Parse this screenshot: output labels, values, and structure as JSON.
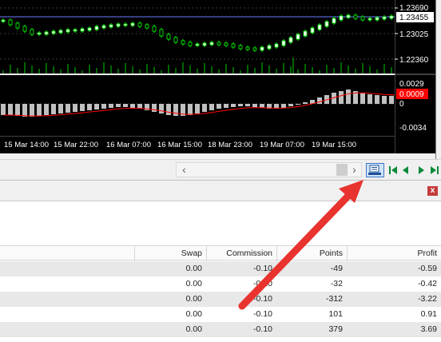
{
  "chart": {
    "price_labels": [
      "1.23690",
      "1.23025",
      "1.22360"
    ],
    "current_price": "1.23455",
    "osc_labels": [
      "0.0029",
      "0",
      "-0.0034"
    ],
    "osc_current": "0.0009",
    "time_labels": [
      "15 Mar 14:00",
      "15 Mar 22:00",
      "16 Mar 07:00",
      "16 Mar 15:00",
      "18 Mar 23:00",
      "19 Mar 07:00",
      "19 Mar 15:00"
    ],
    "colors": {
      "background": "#000000",
      "bull_candle": "#ffffff",
      "bear_candle": "#000000",
      "wick": "#00ff00",
      "volume": "#00cc00",
      "osc_bar": "#c0c0c0",
      "signal_line": "#ff0000",
      "current_price_tag": "#ffffff",
      "osc_tag": "#ff0000"
    }
  },
  "scrollbar": {
    "left_arrow": "‹",
    "right_arrow": "›"
  },
  "nav_icons": [
    "chart-shift-icon",
    "scroll-to-start-icon",
    "scroll-left-icon",
    "scroll-right-icon",
    "scroll-to-end-icon"
  ],
  "terminal": {
    "close_label": "x",
    "columns": [
      "Swap",
      "Commission",
      "Points",
      "Profit"
    ],
    "rows": [
      {
        "swap": "0.00",
        "commission": "-0.10",
        "points": "-49",
        "profit": "-0.59"
      },
      {
        "swap": "0.00",
        "commission": "-0.10",
        "points": "-32",
        "profit": "-0.42"
      },
      {
        "swap": "0.00",
        "commission": "-0.10",
        "points": "-312",
        "profit": "-3.22"
      },
      {
        "swap": "0.00",
        "commission": "-0.10",
        "points": "101",
        "profit": "0.91"
      },
      {
        "swap": "0.00",
        "commission": "-0.10",
        "points": "379",
        "profit": "3.69"
      }
    ]
  },
  "annotation": {
    "arrow_color": "#e8332f"
  }
}
